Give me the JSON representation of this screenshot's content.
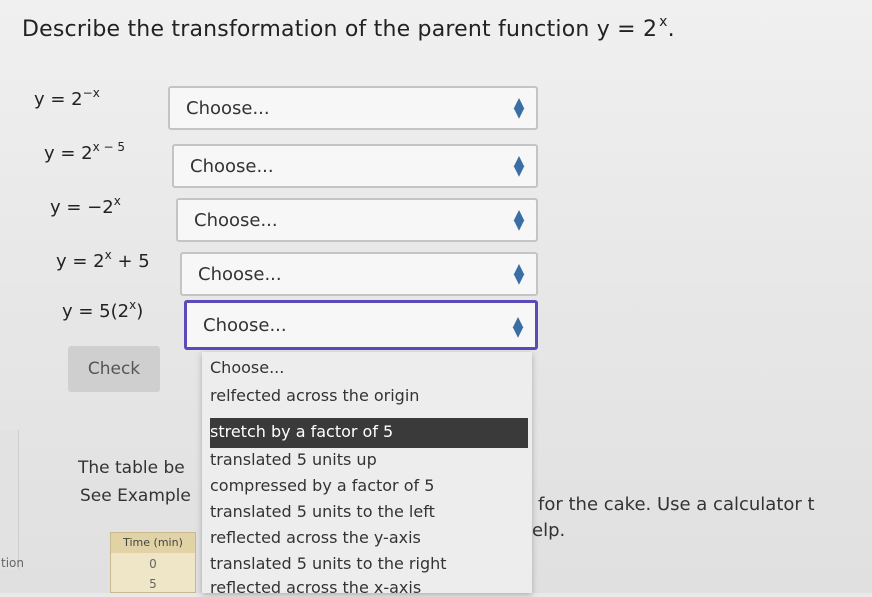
{
  "question": {
    "text": "Describe the transformation of the parent function y = 2",
    "sup": "x"
  },
  "equations": [
    {
      "base": "y = 2",
      "sup": "−x",
      "rest": ""
    },
    {
      "base": "y = 2",
      "sup": "x − 5",
      "rest": ""
    },
    {
      "base": "y = −2",
      "sup": "x",
      "rest": ""
    },
    {
      "base": "y = 2",
      "sup": "x",
      "rest": " + 5"
    },
    {
      "base": "y = 5(2",
      "sup": "x",
      "rest": ")"
    }
  ],
  "selects": [
    {
      "value": "Choose..."
    },
    {
      "value": "Choose..."
    },
    {
      "value": "Choose..."
    },
    {
      "value": "Choose..."
    },
    {
      "value": "Choose..."
    }
  ],
  "check_label": "Check",
  "dropdown": {
    "options": [
      "Choose...",
      "relfected across the origin",
      "stretch by a factor of 5",
      "translated 5 units up",
      "compressed by a factor of 5",
      "translated 5 units to the left",
      "reflected across the y-axis",
      "translated 5 units to the right",
      "reflected across the x-axis"
    ],
    "highlighted_index": 2
  },
  "background_text": {
    "line1": "The table be",
    "line2": "See Example",
    "right1": "for the cake. Use a calculator t",
    "right2": "elp.",
    "left_cut": "tion"
  },
  "mini_table": {
    "header": "Time (min)",
    "rows": [
      "0",
      "5"
    ]
  },
  "colors": {
    "focus_border": "#5b4ab8",
    "arrow": "#3b6ea5",
    "highlight_bg": "#3a3a3a"
  }
}
